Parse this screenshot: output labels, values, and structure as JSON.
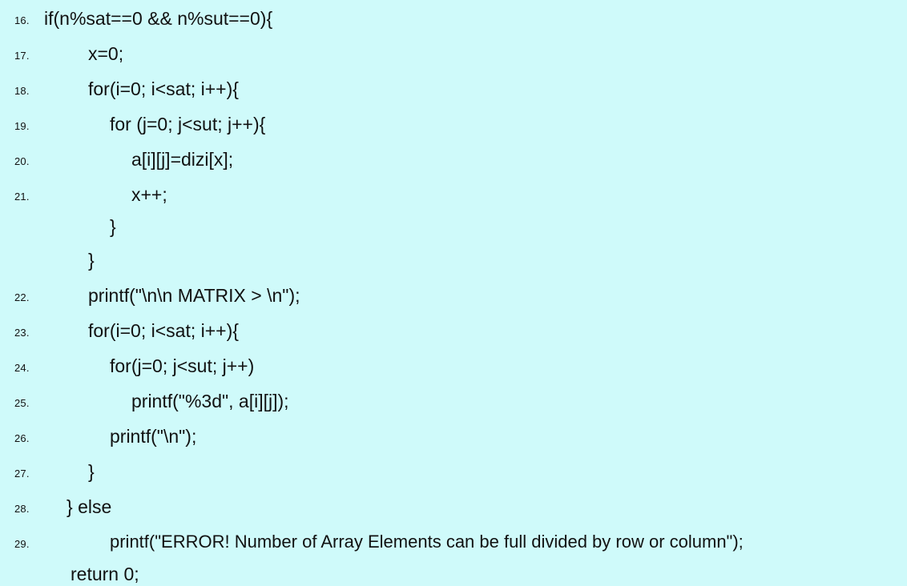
{
  "code_listing": {
    "lines": [
      {
        "number": "16.",
        "code": "if(n%sat==0 && n%sut==0){"
      },
      {
        "number": "17.",
        "code": "x=0;"
      },
      {
        "number": "18.",
        "code": "for(i=0; i<sat; i++){"
      },
      {
        "number": "19.",
        "code": "for (j=0; j<sut; j++){"
      },
      {
        "number": "20.",
        "code": "a[i][j]=dizi[x];"
      },
      {
        "number": "21.",
        "code": "x++;"
      },
      {
        "number": "",
        "code": "}"
      },
      {
        "number": "",
        "code": "}"
      },
      {
        "number": "22.",
        "code": "printf(\"\\n\\n MATRIX > \\n\");"
      },
      {
        "number": "23.",
        "code": "for(i=0; i<sat; i++){"
      },
      {
        "number": "24.",
        "code": "for(j=0; j<sut; j++)"
      },
      {
        "number": "25.",
        "code": "printf(\"%3d\", a[i][j]);"
      },
      {
        "number": "26.",
        "code": "printf(\"\\n\");"
      },
      {
        "number": "27.",
        "code": "}"
      },
      {
        "number": "28.",
        "code": "} else"
      },
      {
        "number": "29.",
        "code": "printf(\"ERROR! Number of Array Elements can be full divided by row or column\");"
      },
      {
        "number": "",
        "code": "return 0;"
      }
    ]
  }
}
